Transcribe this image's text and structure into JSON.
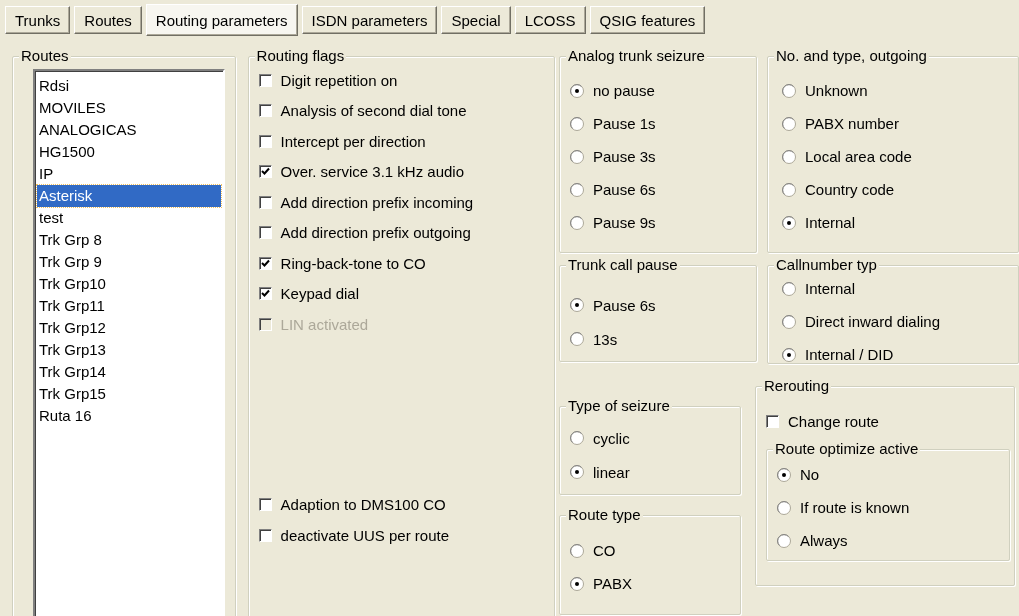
{
  "tabs": [
    {
      "label": "Trunks",
      "selected": false
    },
    {
      "label": "Routes",
      "selected": false
    },
    {
      "label": "Routing parameters",
      "selected": true
    },
    {
      "label": "ISDN parameters",
      "selected": false
    },
    {
      "label": "Special",
      "selected": false
    },
    {
      "label": "LCOSS",
      "selected": false
    },
    {
      "label": "QSIG features",
      "selected": false
    }
  ],
  "routes": {
    "title": "Routes",
    "items": [
      {
        "label": "Rdsi",
        "selected": false
      },
      {
        "label": "MOVILES",
        "selected": false
      },
      {
        "label": "ANALOGICAS",
        "selected": false
      },
      {
        "label": "HG1500",
        "selected": false
      },
      {
        "label": "IP",
        "selected": false
      },
      {
        "label": "Asterisk",
        "selected": true
      },
      {
        "label": "test",
        "selected": false
      },
      {
        "label": "Trk Grp 8",
        "selected": false
      },
      {
        "label": "Trk Grp 9",
        "selected": false
      },
      {
        "label": "Trk Grp10",
        "selected": false
      },
      {
        "label": "Trk Grp11",
        "selected": false
      },
      {
        "label": "Trk Grp12",
        "selected": false
      },
      {
        "label": "Trk Grp13",
        "selected": false
      },
      {
        "label": "Trk Grp14",
        "selected": false
      },
      {
        "label": "Trk Grp15",
        "selected": false
      },
      {
        "label": "Ruta 16",
        "selected": false
      }
    ]
  },
  "routing_flags": {
    "title": "Routing flags",
    "items": [
      {
        "label": "Digit repetition on",
        "checked": false,
        "disabled": false
      },
      {
        "label": "Analysis of second dial tone",
        "checked": false,
        "disabled": false
      },
      {
        "label": "Intercept per direction",
        "checked": false,
        "disabled": false
      },
      {
        "label": "Over. service 3.1 kHz audio",
        "checked": true,
        "disabled": false
      },
      {
        "label": "Add direction prefix incoming",
        "checked": false,
        "disabled": false
      },
      {
        "label": "Add direction prefix outgoing",
        "checked": false,
        "disabled": false
      },
      {
        "label": "Ring-back-tone to CO",
        "checked": true,
        "disabled": false
      },
      {
        "label": "Keypad dial",
        "checked": true,
        "disabled": false
      },
      {
        "label": "LIN activated",
        "checked": false,
        "disabled": true
      }
    ],
    "bottom_items": [
      {
        "label": "Adaption to DMS100 CO",
        "checked": false,
        "disabled": false
      },
      {
        "label": "deactivate UUS per route",
        "checked": false,
        "disabled": false
      }
    ]
  },
  "analog_trunk_seizure": {
    "title": "Analog trunk seizure",
    "options": [
      {
        "label": "no pause",
        "selected": true
      },
      {
        "label": "Pause 1s",
        "selected": false
      },
      {
        "label": "Pause 3s",
        "selected": false
      },
      {
        "label": "Pause 6s",
        "selected": false
      },
      {
        "label": "Pause 9s",
        "selected": false
      }
    ]
  },
  "no_and_type_outgoing": {
    "title": "No. and type, outgoing",
    "options": [
      {
        "label": "Unknown",
        "selected": false
      },
      {
        "label": "PABX number",
        "selected": false
      },
      {
        "label": "Local area code",
        "selected": false
      },
      {
        "label": "Country code",
        "selected": false
      },
      {
        "label": "Internal",
        "selected": true
      }
    ]
  },
  "trunk_call_pause": {
    "title": "Trunk call pause",
    "options": [
      {
        "label": "Pause 6s",
        "selected": true
      },
      {
        "label": "13s",
        "selected": false
      }
    ]
  },
  "callnumber_typ": {
    "title": "Callnumber typ",
    "options": [
      {
        "label": "Internal",
        "selected": false
      },
      {
        "label": "Direct inward dialing",
        "selected": false
      },
      {
        "label": "Internal / DID",
        "selected": true
      }
    ]
  },
  "type_of_seizure": {
    "title": "Type of seizure",
    "options": [
      {
        "label": "cyclic",
        "selected": false
      },
      {
        "label": "linear",
        "selected": true
      }
    ]
  },
  "route_type": {
    "title": "Route type",
    "options": [
      {
        "label": "CO",
        "selected": false
      },
      {
        "label": "PABX",
        "selected": true
      }
    ]
  },
  "rerouting": {
    "title": "Rerouting",
    "change_route": {
      "label": "Change route",
      "checked": false
    },
    "route_optimize_active": {
      "title": "Route optimize active",
      "options": [
        {
          "label": "No",
          "selected": true
        },
        {
          "label": "If route is known",
          "selected": false
        },
        {
          "label": "Always",
          "selected": false
        }
      ]
    }
  }
}
